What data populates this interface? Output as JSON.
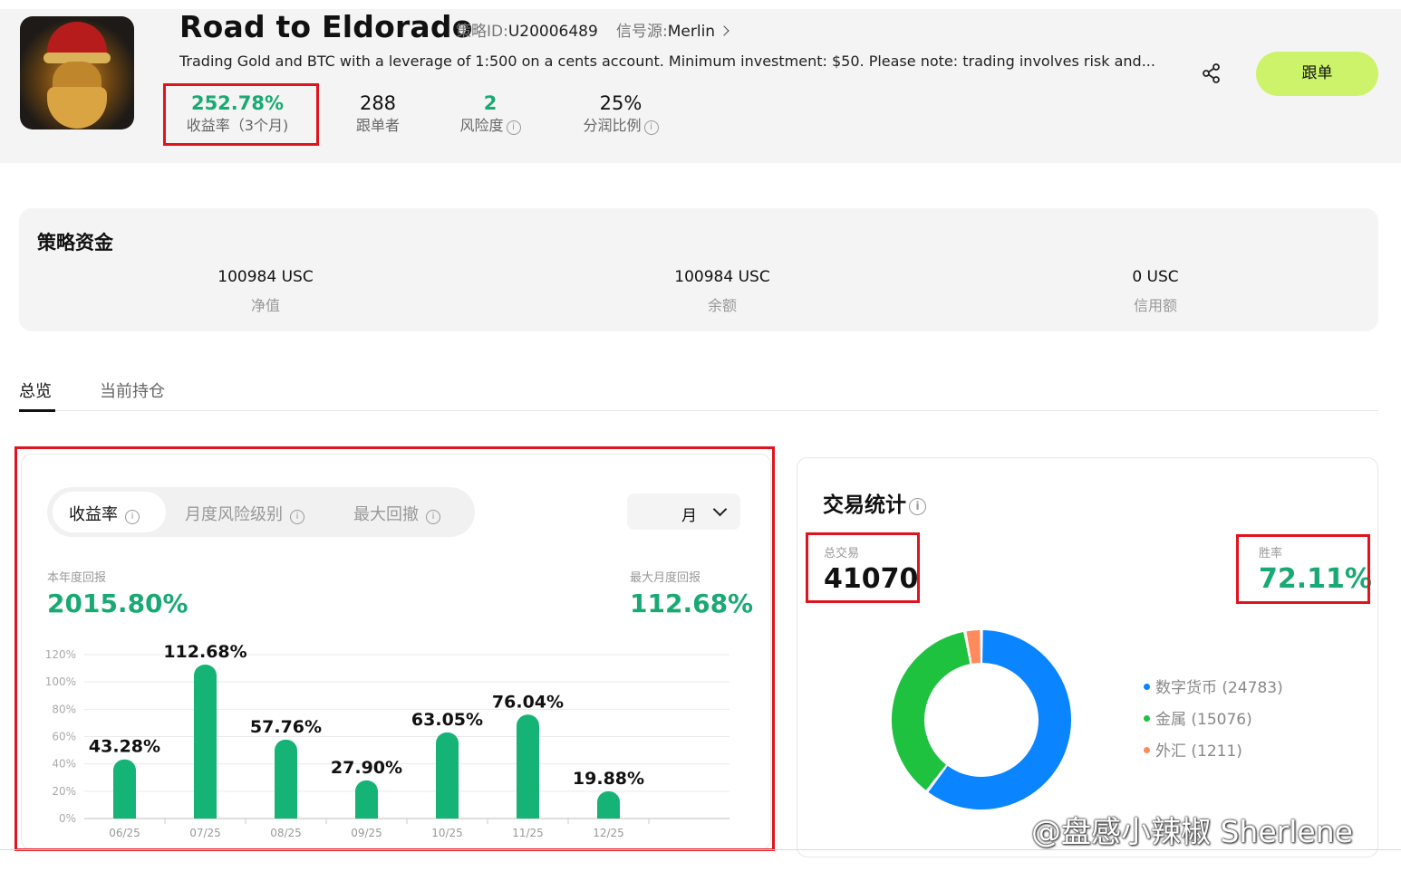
{
  "header": {
    "title": "Road to Eldorado",
    "strategy_id_label": "策略ID:",
    "strategy_id": "U20006489",
    "signal_source_label": "信号源:",
    "signal_source": "Merlin",
    "description": "Trading Gold and BTC with a leverage of 1:500 on a cents account. Minimum investment: $50. Please note: trading involves risk and...",
    "stats": [
      {
        "value": "252.78%",
        "label": "收益率（3个月)"
      },
      {
        "value": "288",
        "label": "跟单者"
      },
      {
        "value": "2",
        "label": "风险度"
      },
      {
        "value": "25%",
        "label": "分润比例"
      }
    ],
    "follow_button": "跟单",
    "share_icon": "share-icon"
  },
  "funds": {
    "title": "策略资金",
    "items": [
      {
        "value": "100984 USC",
        "label": "净值"
      },
      {
        "value": "100984 USC",
        "label": "余额"
      },
      {
        "value": "0 USC",
        "label": "信用额"
      }
    ]
  },
  "tabs": [
    {
      "label": "总览",
      "active": true
    },
    {
      "label": "当前持仓",
      "active": false
    }
  ],
  "returns": {
    "segments": [
      "收益率",
      "月度风险级别",
      "最大回撤"
    ],
    "active_segment": "收益率",
    "period": "月",
    "ytd_label": "本年度回报",
    "ytd_value": "2015.80%",
    "max_month_label": "最大月度回报",
    "max_month_value": "112.68%"
  },
  "chart_data": {
    "type": "bar",
    "categories": [
      "06/25",
      "07/25",
      "08/25",
      "09/25",
      "10/25",
      "11/25",
      "12/25"
    ],
    "values": [
      43.28,
      112.68,
      57.76,
      27.9,
      63.05,
      76.04,
      19.88
    ],
    "value_labels": [
      "43.28%",
      "112.68%",
      "57.76%",
      "27.90%",
      "63.05%",
      "76.04%",
      "19.88%"
    ],
    "ylim": [
      0,
      120
    ],
    "yticks": [
      "0%",
      "20%",
      "40%",
      "60%",
      "80%",
      "100%",
      "120%"
    ],
    "grid": true,
    "bar_color": "#16b377"
  },
  "trade_stats": {
    "title": "交易统计",
    "total_label": "总交易",
    "total_value": "41070",
    "winrate_label": "胜率",
    "winrate_value": "72.11%",
    "legend": [
      {
        "label": "数字货币 (24783)",
        "value": 24783,
        "color": "#0a84ff"
      },
      {
        "label": "金属 (15076)",
        "value": 15076,
        "color": "#1ec23f"
      },
      {
        "label": "外汇 (1211)",
        "value": 1211,
        "color": "#ff8a5b"
      }
    ]
  },
  "watermark": "@盘感小辣椒 Sherlene",
  "colors": {
    "accent_green": "#19a974",
    "follow_button": "#ccf36a",
    "highlight_red": "#e0141f"
  }
}
